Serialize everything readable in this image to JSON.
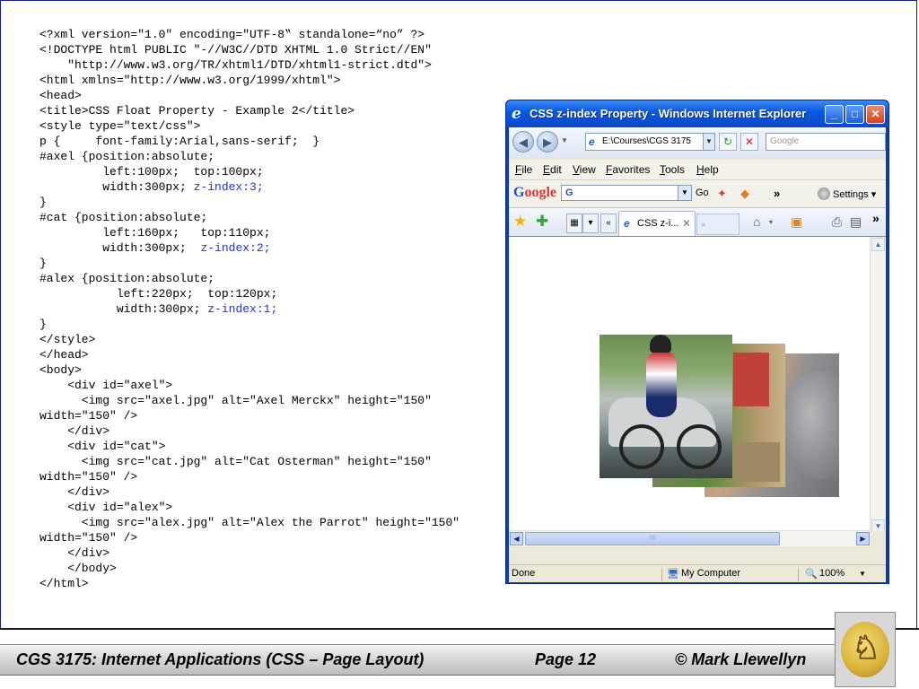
{
  "code_lines": [
    "<?xml version=\"1.0\" encoding=\"UTF-8‟ standalone=“no” ?>",
    "<!DOCTYPE html PUBLIC \"-//W3C//DTD XHTML 1.0 Strict//EN\"",
    "    \"http://www.w3.org/TR/xhtml1/DTD/xhtml1-strict.dtd\">",
    "<html xmlns=\"http://www.w3.org/1999/xhtml\">",
    "<head>",
    "<title>CSS Float Property - Example 2</title>",
    "<style type=\"text/css\">",
    "p {     font-family:Arial,sans-serif;  }",
    "#axel {position:absolute;",
    "         left:100px;  top:100px;",
    "         width:300px; ",
    "}",
    "#cat {position:absolute;",
    "         left:160px;   top:110px;",
    "         width:300px;  ",
    "}",
    "#alex {position:absolute;",
    "           left:220px;  top:120px;",
    "           width:300px; ",
    "}",
    "</style>",
    "</head>",
    "<body>",
    "    <div id=\"axel\">",
    "      <img src=\"axel.jpg\" alt=\"Axel Merckx\" height=\"150\"",
    "width=\"150\" />",
    "    </div>",
    "    <div id=\"cat\">",
    "      <img src=\"cat.jpg\" alt=\"Cat Osterman\" height=\"150\"",
    "width=\"150\" />",
    "    </div>",
    "    <div id=\"alex\">",
    "      <img src=\"alex.jpg\" alt=\"Alex the Parrot\" height=\"150\"",
    "width=\"150\" />",
    "    </div>",
    "    </body>",
    "</html>"
  ],
  "code_highlights": {
    "axel_z": "z-index:3;",
    "cat_z": "z-index:2;",
    "alex_z": "z-index:1;"
  },
  "browser": {
    "title": "CSS z-index Property - Windows Internet Explorer",
    "window_buttons": {
      "minimize": "_",
      "maximize": "□",
      "close": "✕"
    },
    "address": "E:\\Courses\\CGS 3175",
    "search_placeholder": "Google",
    "menu": [
      "File",
      "Edit",
      "View",
      "Favorites",
      "Tools",
      "Help"
    ],
    "google_toolbar": {
      "logo_g": "G",
      "logo_rest": "oogle",
      "box_value": "G",
      "go": "Go",
      "more": "»",
      "settings": "Settings ▾"
    },
    "tab_label": "CSS z-i...",
    "new_tab": "»",
    "status_text": "Done",
    "zone": "My Computer",
    "zoom": "100%",
    "scroll_grip": "III"
  },
  "footer": {
    "course": "CGS 3175: Internet Applications (CSS – Page Layout)",
    "page": "Page 12",
    "author": "© Mark Llewellyn"
  },
  "colors": {
    "code_highlight": "#2233cc",
    "title_bar": "#0b5ae0"
  }
}
